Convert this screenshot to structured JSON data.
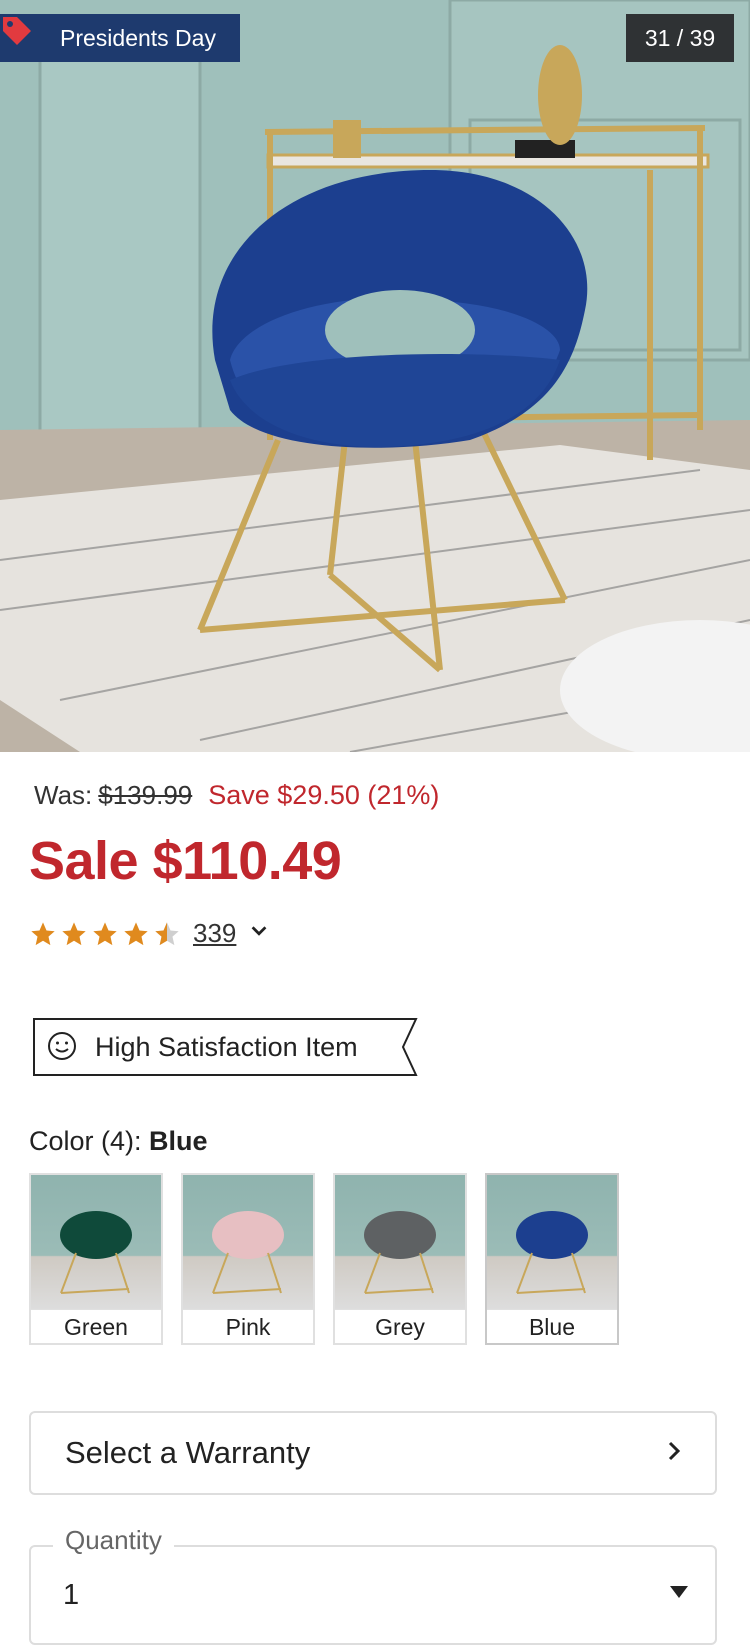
{
  "gallery": {
    "promo_label": "Presidents Day",
    "counter": "31 / 39",
    "image_description_icon": "blue-velvet-chair-photo"
  },
  "price": {
    "was_label": "Was:",
    "was_price": "$139.99",
    "save_text": "Save $29.50 (21%)",
    "sale_text": "Sale $110.49"
  },
  "rating": {
    "stars": 4.5,
    "count": "339"
  },
  "badge": {
    "label": "High Satisfaction Item"
  },
  "color": {
    "title_prefix": "Color (4):",
    "selected": "Blue",
    "options": [
      {
        "label": "Green",
        "hex": "#0f4a3a"
      },
      {
        "label": "Pink",
        "hex": "#e7bfc2"
      },
      {
        "label": "Grey",
        "hex": "#5e6163"
      },
      {
        "label": "Blue",
        "hex": "#1c3f8f"
      }
    ]
  },
  "warranty": {
    "label": "Select a Warranty"
  },
  "quantity": {
    "label": "Quantity",
    "value": "1"
  },
  "colors": {
    "sale_red": "#c0272d",
    "promo_navy": "#1e3a6e",
    "star_orange": "#e08a1e"
  }
}
